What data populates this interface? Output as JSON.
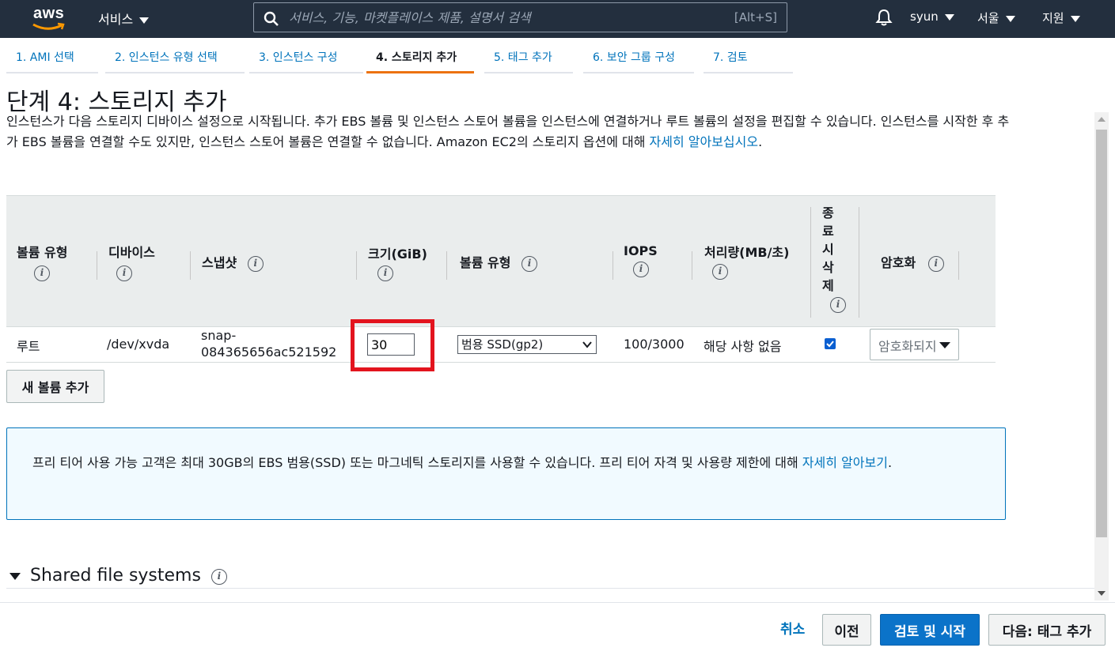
{
  "topnav": {
    "logo_text": "aws",
    "services_label": "서비스",
    "search_placeholder": "서비스, 기능, 마켓플레이스 제품, 설명서 검색",
    "search_shortcut": "[Alt+S]",
    "user_label": "syun",
    "region_label": "서울",
    "support_label": "지원"
  },
  "steps": [
    {
      "label": "1. AMI 선택",
      "active": false
    },
    {
      "label": "2. 인스턴스 유형 선택",
      "active": false
    },
    {
      "label": "3. 인스턴스 구성",
      "active": false
    },
    {
      "label": "4. 스토리지 추가",
      "active": true
    },
    {
      "label": "5. 태그 추가",
      "active": false
    },
    {
      "label": "6. 보안 그룹 구성",
      "active": false
    },
    {
      "label": "7. 검토",
      "active": false
    }
  ],
  "page": {
    "title": "단계 4: 스토리지 추가",
    "description": "인스턴스가 다음 스토리지 디바이스 설정으로 시작됩니다. 추가 EBS 볼륨 및 인스턴스 스토어 볼륨을 인스턴스에 연결하거나 루트 볼륨의 설정을 편집할 수 있습니다. 인스턴스를 시작한 후 추가 EBS 볼륨을 연결할 수도 있지만, 인스턴스 스토어 볼륨은 연결할 수 없습니다. Amazon EC2의 스토리지 옵션에 대해 ",
    "description_link": "자세히 알아보십시오",
    "description_end": "."
  },
  "table": {
    "headers": {
      "volume_type": "볼륨 유형",
      "device": "디바이스",
      "snapshot": "스냅샷",
      "size": "크기(GiB)",
      "volume_kind": "볼륨 유형",
      "iops": "IOPS",
      "throughput": "처리량(MB/초)",
      "delete_on_term": [
        "종",
        "료",
        "시",
        "삭",
        "제"
      ],
      "encryption": "암호화"
    },
    "row": {
      "volume_type": "루트",
      "device": "/dev/xvda",
      "snapshot_line1": "snap-",
      "snapshot_line2": "084365656ac521592",
      "size": "30",
      "volume_kind": "범용 SSD(gp2)",
      "iops": "100/3000",
      "throughput": "해당 사항 없음",
      "delete_on_termination": true,
      "encryption": "암호화되지 않음"
    }
  },
  "add_volume_label": "새 볼륨 추가",
  "infobox": {
    "text": "프리 티어 사용 가능 고객은 최대 30GB의 EBS 범용(SSD) 또는 마그네틱 스토리지를 사용할 수 있습니다. 프리 티어 자격 및 사용량 제한에 대해 ",
    "link": "자세히 알아보기",
    "end": "."
  },
  "shared_fs_label": "Shared file systems",
  "buttons": {
    "cancel": "취소",
    "previous": "이전",
    "review_launch": "검토 및 시작",
    "next": "다음: 태그 추가"
  },
  "colors": {
    "nav_bg": "#232f3e",
    "link": "#0073bb",
    "active_step": "#ec7211",
    "primary_button": "#0b73c9",
    "highlight_box": "#e3141e"
  }
}
